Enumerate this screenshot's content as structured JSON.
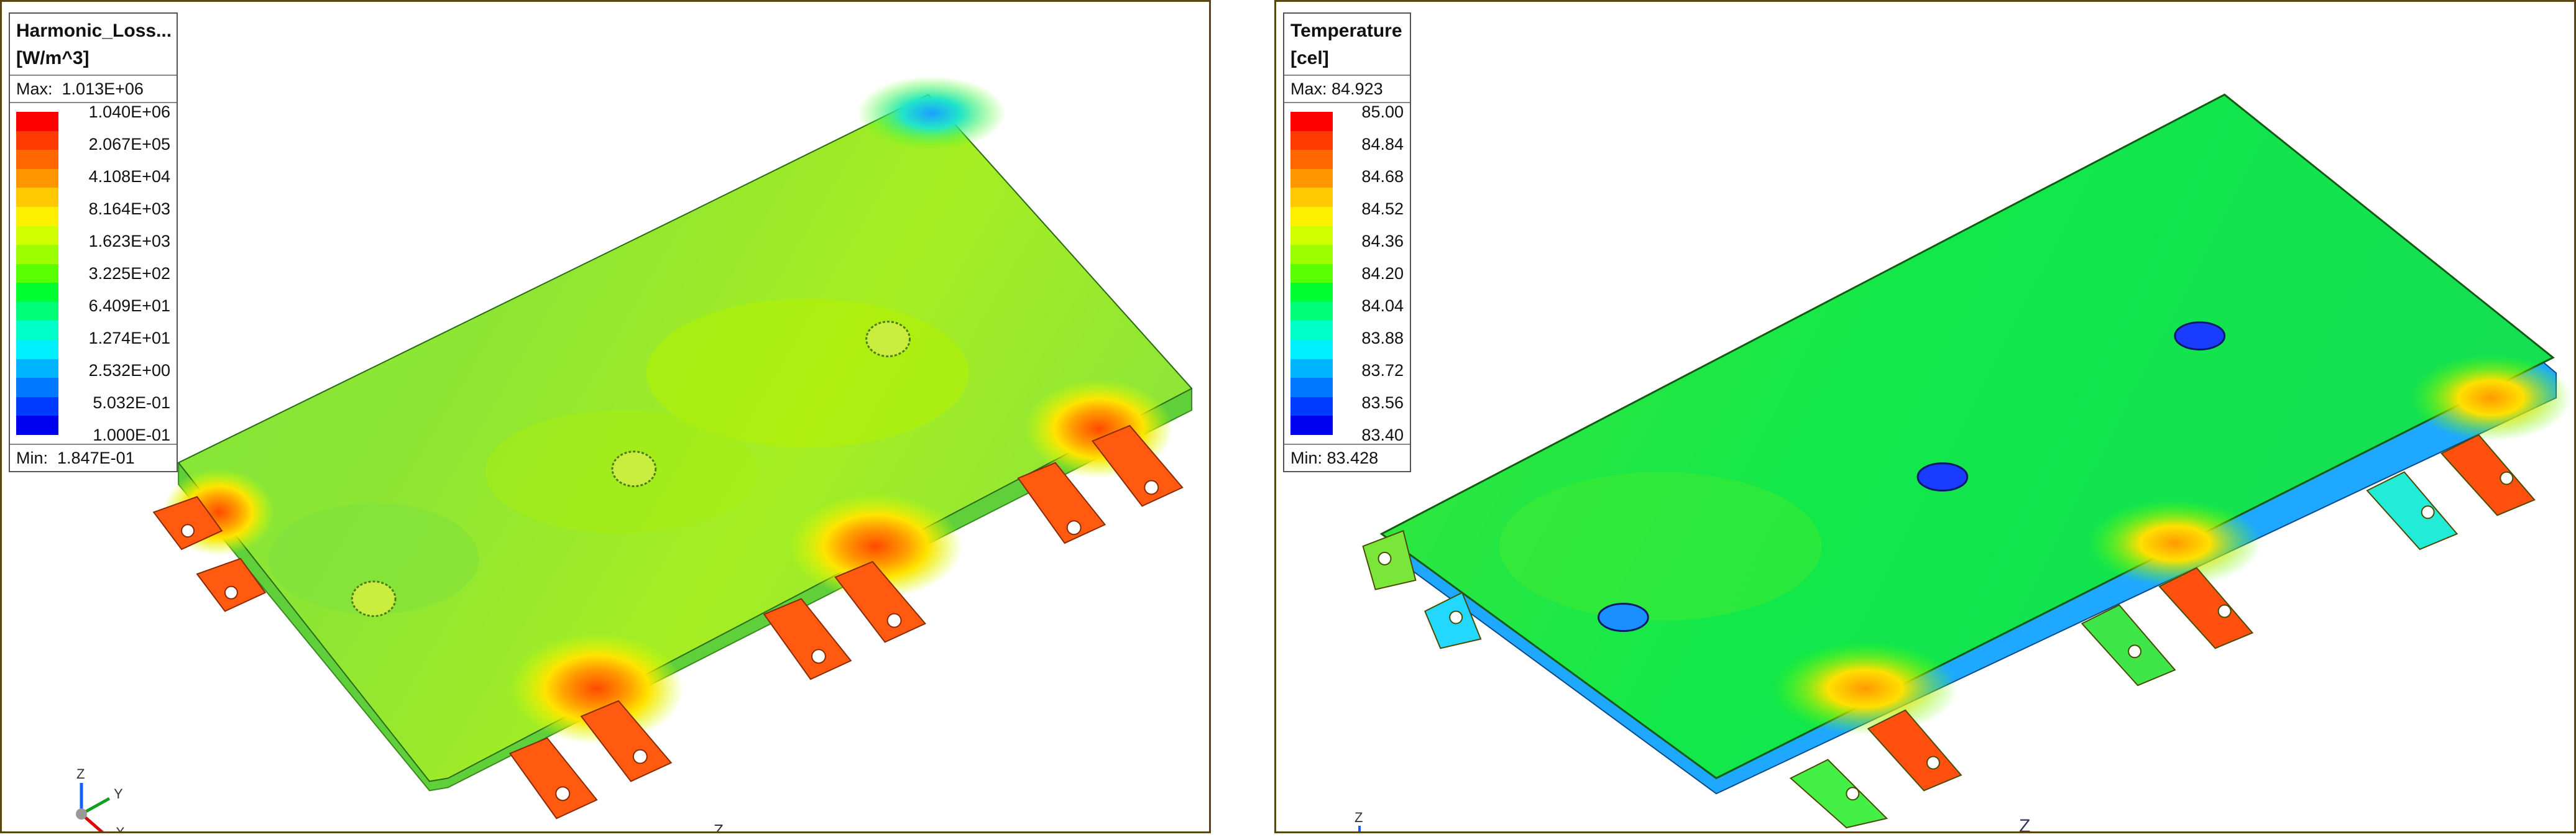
{
  "left_view": {
    "legend": {
      "title": "Harmonic_Loss...\n[W/m^3]",
      "max_label": "Max:",
      "max_value": "1.013E+06",
      "min_label": "Min:",
      "min_value": "1.847E-01",
      "ticks": [
        "1.040E+06",
        "2.067E+05",
        "4.108E+04",
        "8.164E+03",
        "1.623E+03",
        "3.225E+02",
        "6.409E+01",
        "1.274E+01",
        "2.532E+00",
        "5.032E-01",
        "1.000E-01"
      ],
      "colors": [
        "#ff0000",
        "#ff3a00",
        "#ff6600",
        "#ff9600",
        "#ffc800",
        "#fff000",
        "#d2ff00",
        "#9cff00",
        "#5aff00",
        "#00ff30",
        "#00ff78",
        "#00ffc8",
        "#00f0ff",
        "#00b4ff",
        "#0078ff",
        "#003cff",
        "#0000f0"
      ]
    },
    "triad": {
      "axes": [
        "Z",
        "Y",
        "X"
      ]
    },
    "edge_axis_label": "Z"
  },
  "right_view": {
    "legend": {
      "title": "Temperature\n[cel]",
      "max_label": "Max:",
      "max_value": "84.923",
      "min_label": "Min:",
      "min_value": "83.428",
      "ticks": [
        "85.00",
        "84.84",
        "84.68",
        "84.52",
        "84.36",
        "84.20",
        "84.04",
        "83.88",
        "83.72",
        "83.56",
        "83.40"
      ],
      "colors": [
        "#ff0000",
        "#ff3a00",
        "#ff6600",
        "#ff9600",
        "#ffc800",
        "#fff000",
        "#d2ff00",
        "#9cff00",
        "#5aff00",
        "#00ff30",
        "#00ff78",
        "#00ffc8",
        "#00f0ff",
        "#00b4ff",
        "#0078ff",
        "#003cff",
        "#0000f0"
      ]
    },
    "triad": {
      "axes": [
        "Z"
      ]
    },
    "edge_axis_label": "Z"
  }
}
